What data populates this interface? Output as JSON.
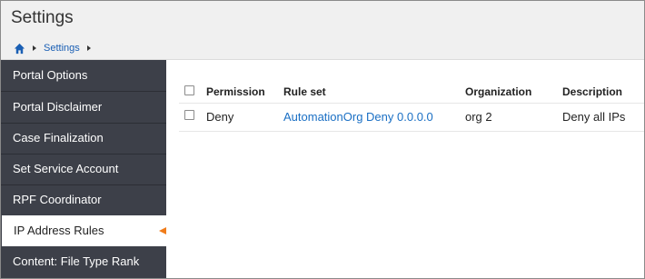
{
  "header": {
    "title": "Settings",
    "breadcrumb": {
      "home_icon": "home-icon",
      "settings_label": "Settings"
    }
  },
  "sidebar": {
    "items": [
      {
        "label": "Portal Options",
        "active": false
      },
      {
        "label": "Portal Disclaimer",
        "active": false
      },
      {
        "label": "Case Finalization",
        "active": false
      },
      {
        "label": "Set Service Account",
        "active": false
      },
      {
        "label": "RPF Coordinator",
        "active": false
      },
      {
        "label": "IP Address Rules",
        "active": true
      },
      {
        "label": "Content: File Type Rank",
        "active": false
      }
    ]
  },
  "table": {
    "columns": [
      "Permission",
      "Rule set",
      "Organization",
      "Description"
    ],
    "rows": [
      {
        "permission": "Deny",
        "rule_set": "AutomationOrg Deny 0.0.0.0",
        "organization": "org 2",
        "description": "Deny all IPs"
      }
    ]
  },
  "colors": {
    "sidebar_bg": "#3d4049",
    "link": "#1a6fc4",
    "arrow": "#f07c1a"
  }
}
